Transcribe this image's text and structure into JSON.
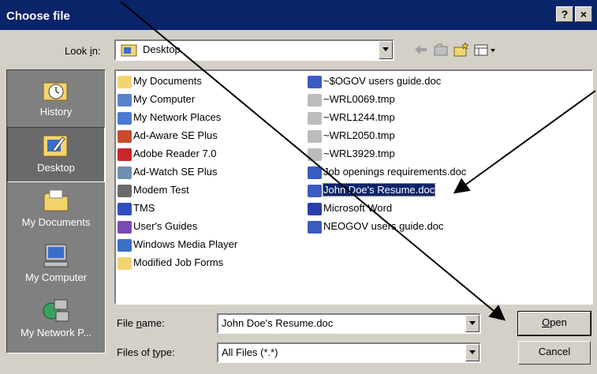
{
  "window": {
    "title": "Choose file",
    "help": "?",
    "close": "×"
  },
  "lookin": {
    "label_pre": "Look ",
    "label_u": "i",
    "label_post": "n:",
    "value": "Desktop"
  },
  "places": [
    {
      "label": "History",
      "icon": "history-icon"
    },
    {
      "label": "Desktop",
      "icon": "desktop-icon",
      "selected": true
    },
    {
      "label": "My Documents",
      "icon": "folder-icon"
    },
    {
      "label": "My Computer",
      "icon": "computer-icon"
    },
    {
      "label": "My Network P...",
      "icon": "network-icon"
    }
  ],
  "files_left": [
    {
      "name": "My Documents",
      "icon": "my-documents-icon",
      "color": "#f2d46f"
    },
    {
      "name": "My Computer",
      "icon": "my-computer-icon",
      "color": "#5a82c8"
    },
    {
      "name": "My Network Places",
      "icon": "network-places-icon",
      "color": "#4a7bd0"
    },
    {
      "name": "Ad-Aware SE Plus",
      "icon": "ad-aware-icon",
      "color": "#c84b2e"
    },
    {
      "name": "Adobe Reader 7.0",
      "icon": "adobe-reader-icon",
      "color": "#c8262c"
    },
    {
      "name": "Ad-Watch SE Plus",
      "icon": "ad-watch-icon",
      "color": "#6e8fb0"
    },
    {
      "name": "Modem Test",
      "icon": "modem-test-icon",
      "color": "#6a6a6a"
    },
    {
      "name": "TMS",
      "icon": "tms-icon",
      "color": "#3050c0"
    },
    {
      "name": "User's Guides",
      "icon": "users-guides-icon",
      "color": "#7a4bb0"
    },
    {
      "name": "Windows Media Player",
      "icon": "media-player-icon",
      "color": "#3a6ec8"
    },
    {
      "name": "Modified Job Forms",
      "icon": "folder-icon",
      "color": "#f2d46f"
    }
  ],
  "files_right": [
    {
      "name": "~$OGOV users guide.doc",
      "icon": "word-doc-icon",
      "color": "#3a5cc0"
    },
    {
      "name": "~WRL0069.tmp",
      "icon": "tmp-file-icon",
      "color": "#bcbcbc"
    },
    {
      "name": "~WRL1244.tmp",
      "icon": "tmp-file-icon",
      "color": "#bcbcbc"
    },
    {
      "name": "~WRL2050.tmp",
      "icon": "tmp-file-icon",
      "color": "#bcbcbc"
    },
    {
      "name": "~WRL3929.tmp",
      "icon": "tmp-file-icon",
      "color": "#bcbcbc"
    },
    {
      "name": "Job openings requirements.doc",
      "icon": "word-doc-icon",
      "color": "#3a5cc0"
    },
    {
      "name": "John Doe's Resume.doc",
      "icon": "word-doc-icon",
      "color": "#3a5cc0",
      "selected": true
    },
    {
      "name": "Microsoft Word",
      "icon": "word-app-icon",
      "color": "#2b3fa8"
    },
    {
      "name": "NEOGOV users guide.doc",
      "icon": "word-doc-icon",
      "color": "#3a5cc0"
    }
  ],
  "filename": {
    "label_pre": "File ",
    "label_u": "n",
    "label_post": "ame:",
    "value": "John Doe's Resume.doc"
  },
  "filetype": {
    "label_pre": "Files of ",
    "label_u": "t",
    "label_post": "ype:",
    "value": "All Files (*.*)"
  },
  "buttons": {
    "open_u": "O",
    "open_rest": "pen",
    "cancel": "Cancel"
  },
  "colors": {
    "titlebar": "#0a246a",
    "face": "#d4d0c8",
    "selection": "#0a246a"
  }
}
